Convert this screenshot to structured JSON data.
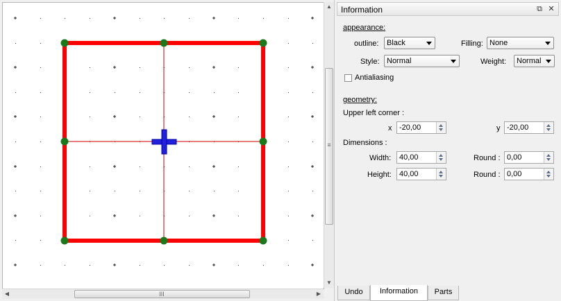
{
  "canvas": {
    "scrollbar": {
      "grip_label": "III",
      "v_grip_label": "≡"
    }
  },
  "panel": {
    "title": "Information",
    "appearance": {
      "section_label": "appearance:",
      "outline_label": "outline:",
      "outline_value": "Black",
      "filling_label": "Filling:",
      "filling_value": "None",
      "style_label": "Style:",
      "style_value": "Normal",
      "weight_label": "Weight:",
      "weight_value": "Normal",
      "antialiasing_label": "Antialiasing",
      "antialiasing_checked": false
    },
    "geometry": {
      "section_label": "geometry:",
      "upper_left_label": "Upper left corner :",
      "x_label": "x",
      "x_value": "-20,00",
      "y_label": "y",
      "y_value": "-20,00",
      "dimensions_label": "Dimensions :",
      "width_label": "Width:",
      "width_value": "40,00",
      "height_label": "Height:",
      "height_value": "40,00",
      "round1_label": "Round :",
      "round1_value": "0,00",
      "round2_label": "Round :",
      "round2_value": "0,00"
    }
  },
  "tabs": [
    {
      "label": "Undo",
      "active": false
    },
    {
      "label": "Information",
      "active": true
    },
    {
      "label": "Parts",
      "active": false
    }
  ],
  "colors": {
    "shape_outline": "#ff0000",
    "handle": "#1a7a1a",
    "center_cross": "#2020e0",
    "guide_line": "#cc0000"
  }
}
